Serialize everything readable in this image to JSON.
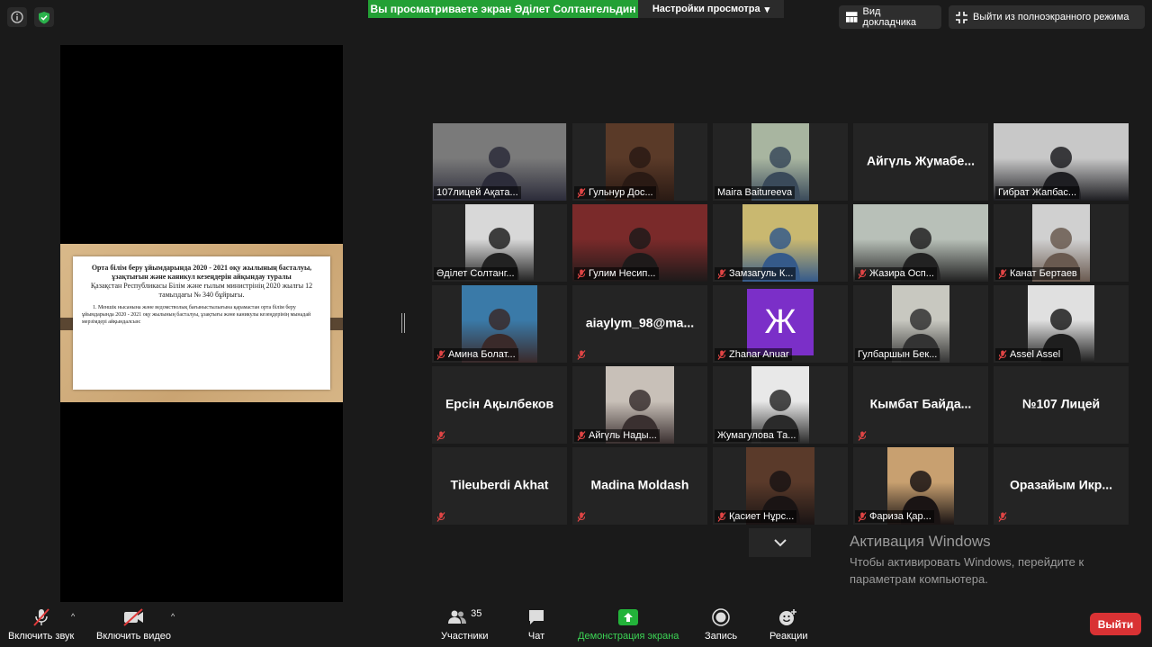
{
  "banner": {
    "viewing_text": "Вы просматриваете экран Әділет Солтангельдин",
    "view_options": "Настройки просмотра"
  },
  "top_controls": {
    "speaker_view": "Вид докладчика",
    "exit_fullscreen": "Выйти из полноэкранного режима"
  },
  "shared_document": {
    "title": "Орта білім беру ұйымдарында 2020 - 2021 оқу жылының басталуы, ұзақтығын және каникул кезеңдерін айқындау туралы",
    "subtitle": "Қазақстан Республикасы Білім және ғылым министрінің 2020 жылғы 12 тамыздағы № 340 бұйрығы.",
    "body": "1. Меншік нысанына және ведомстволық бағыныстылығына қарамастан орта білім беру ұйымдарында 2020 - 2021 оқу жылының басталуы, ұзақтығы және каникулы кезеңдерінің мынадай мерзімдері айқындалсын:"
  },
  "participants": [
    {
      "name": "107лицей Ақата...",
      "video": true,
      "muted": false,
      "bg": "#7a7a7a",
      "fg": "#2c2c3a",
      "vw": 148,
      "active": false
    },
    {
      "name": "Гульнур Дос...",
      "video": true,
      "muted": true,
      "bg": "#5a3a28",
      "fg": "#2a1a14",
      "vw": 76,
      "active": false
    },
    {
      "name": "Maira Baitureeva",
      "video": true,
      "muted": false,
      "bg": "#a8b5a0",
      "fg": "#3a4a5a",
      "vw": 64,
      "active": false
    },
    {
      "name": "Айгүль Жумабе...",
      "video": false,
      "muted": false,
      "active": false
    },
    {
      "name": "Гибрат Жапбас...",
      "video": true,
      "muted": false,
      "bg": "#c8c8c8",
      "fg": "#1e1e22",
      "vw": 150,
      "active": true
    },
    {
      "name": "Әділет Солтанг...",
      "video": true,
      "muted": false,
      "bg": "#d8d8d8",
      "fg": "#222",
      "vw": 76,
      "active": false
    },
    {
      "name": "Гулим Несип...",
      "video": true,
      "muted": true,
      "bg": "#7a2a2a",
      "fg": "#1e1a1a",
      "vw": 150,
      "active": false
    },
    {
      "name": "Замзагуль К...",
      "video": true,
      "muted": true,
      "bg": "#c9b870",
      "fg": "#355a8a",
      "vw": 84,
      "active": false
    },
    {
      "name": "Жазира Осп...",
      "video": true,
      "muted": true,
      "bg": "#b8c0b8",
      "fg": "#222",
      "vw": 150,
      "active": false
    },
    {
      "name": "Канат Бертаев",
      "video": true,
      "muted": true,
      "bg": "#d0d0d0",
      "fg": "#6a5a50",
      "vw": 64,
      "active": false
    },
    {
      "name": "Амина Болат...",
      "video": true,
      "muted": true,
      "bg": "#3a7aa8",
      "fg": "#3a2a2a",
      "vw": 84,
      "active": false
    },
    {
      "name": "aiaylym_98@ma...",
      "video": false,
      "muted": true,
      "active": false
    },
    {
      "name": "Zhanar Anuar",
      "video": false,
      "muted": true,
      "letter": "Ж",
      "letter_bg": "#7b2fc8",
      "active": false
    },
    {
      "name": "Гулбаршын Бек...",
      "video": true,
      "muted": false,
      "bg": "#c8c8c0",
      "fg": "#333",
      "vw": 64,
      "active": false
    },
    {
      "name": "Assel Assel",
      "video": true,
      "muted": true,
      "bg": "#e0e0e0",
      "fg": "#1e1e1e",
      "vw": 74,
      "active": false
    },
    {
      "name": "Ерсін Ақылбеков",
      "video": false,
      "muted": true,
      "active": false
    },
    {
      "name": "Айгүль Нады...",
      "video": true,
      "muted": true,
      "bg": "#c8c0b8",
      "fg": "#3a3030",
      "vw": 76,
      "active": false
    },
    {
      "name": "Жумагулова Та...",
      "video": true,
      "muted": false,
      "bg": "#e8e8e8",
      "fg": "#2a2a2a",
      "vw": 64,
      "active": false
    },
    {
      "name": "Кымбат Байда...",
      "video": false,
      "muted": true,
      "active": false
    },
    {
      "name": "№107 Лицей",
      "video": false,
      "muted": false,
      "active": false
    },
    {
      "name": "Tileuberdi Akhat",
      "video": false,
      "muted": true,
      "active": false
    },
    {
      "name": "Madina Moldash",
      "video": false,
      "muted": true,
      "active": false
    },
    {
      "name": "Қасиет Нұрс...",
      "video": true,
      "muted": true,
      "bg": "#5a3a2a",
      "fg": "#1a1414",
      "vw": 76,
      "active": false
    },
    {
      "name": "Фариза Қар...",
      "video": true,
      "muted": true,
      "bg": "#c8a070",
      "fg": "#1a1414",
      "vw": 74,
      "active": false
    },
    {
      "name": "Оразайым Икр...",
      "video": false,
      "muted": true,
      "active": false
    }
  ],
  "windows_activation": {
    "title": "Активация Windows",
    "text": "Чтобы активировать Windows, перейдите к параметрам компьютера."
  },
  "toolbar": {
    "unmute": "Включить звук",
    "start_video": "Включить видео",
    "participants": "Участники",
    "participants_count": "35",
    "chat": "Чат",
    "share_screen": "Демонстрация экрана",
    "record": "Запись",
    "reactions": "Реакции",
    "end": "Выйти"
  }
}
